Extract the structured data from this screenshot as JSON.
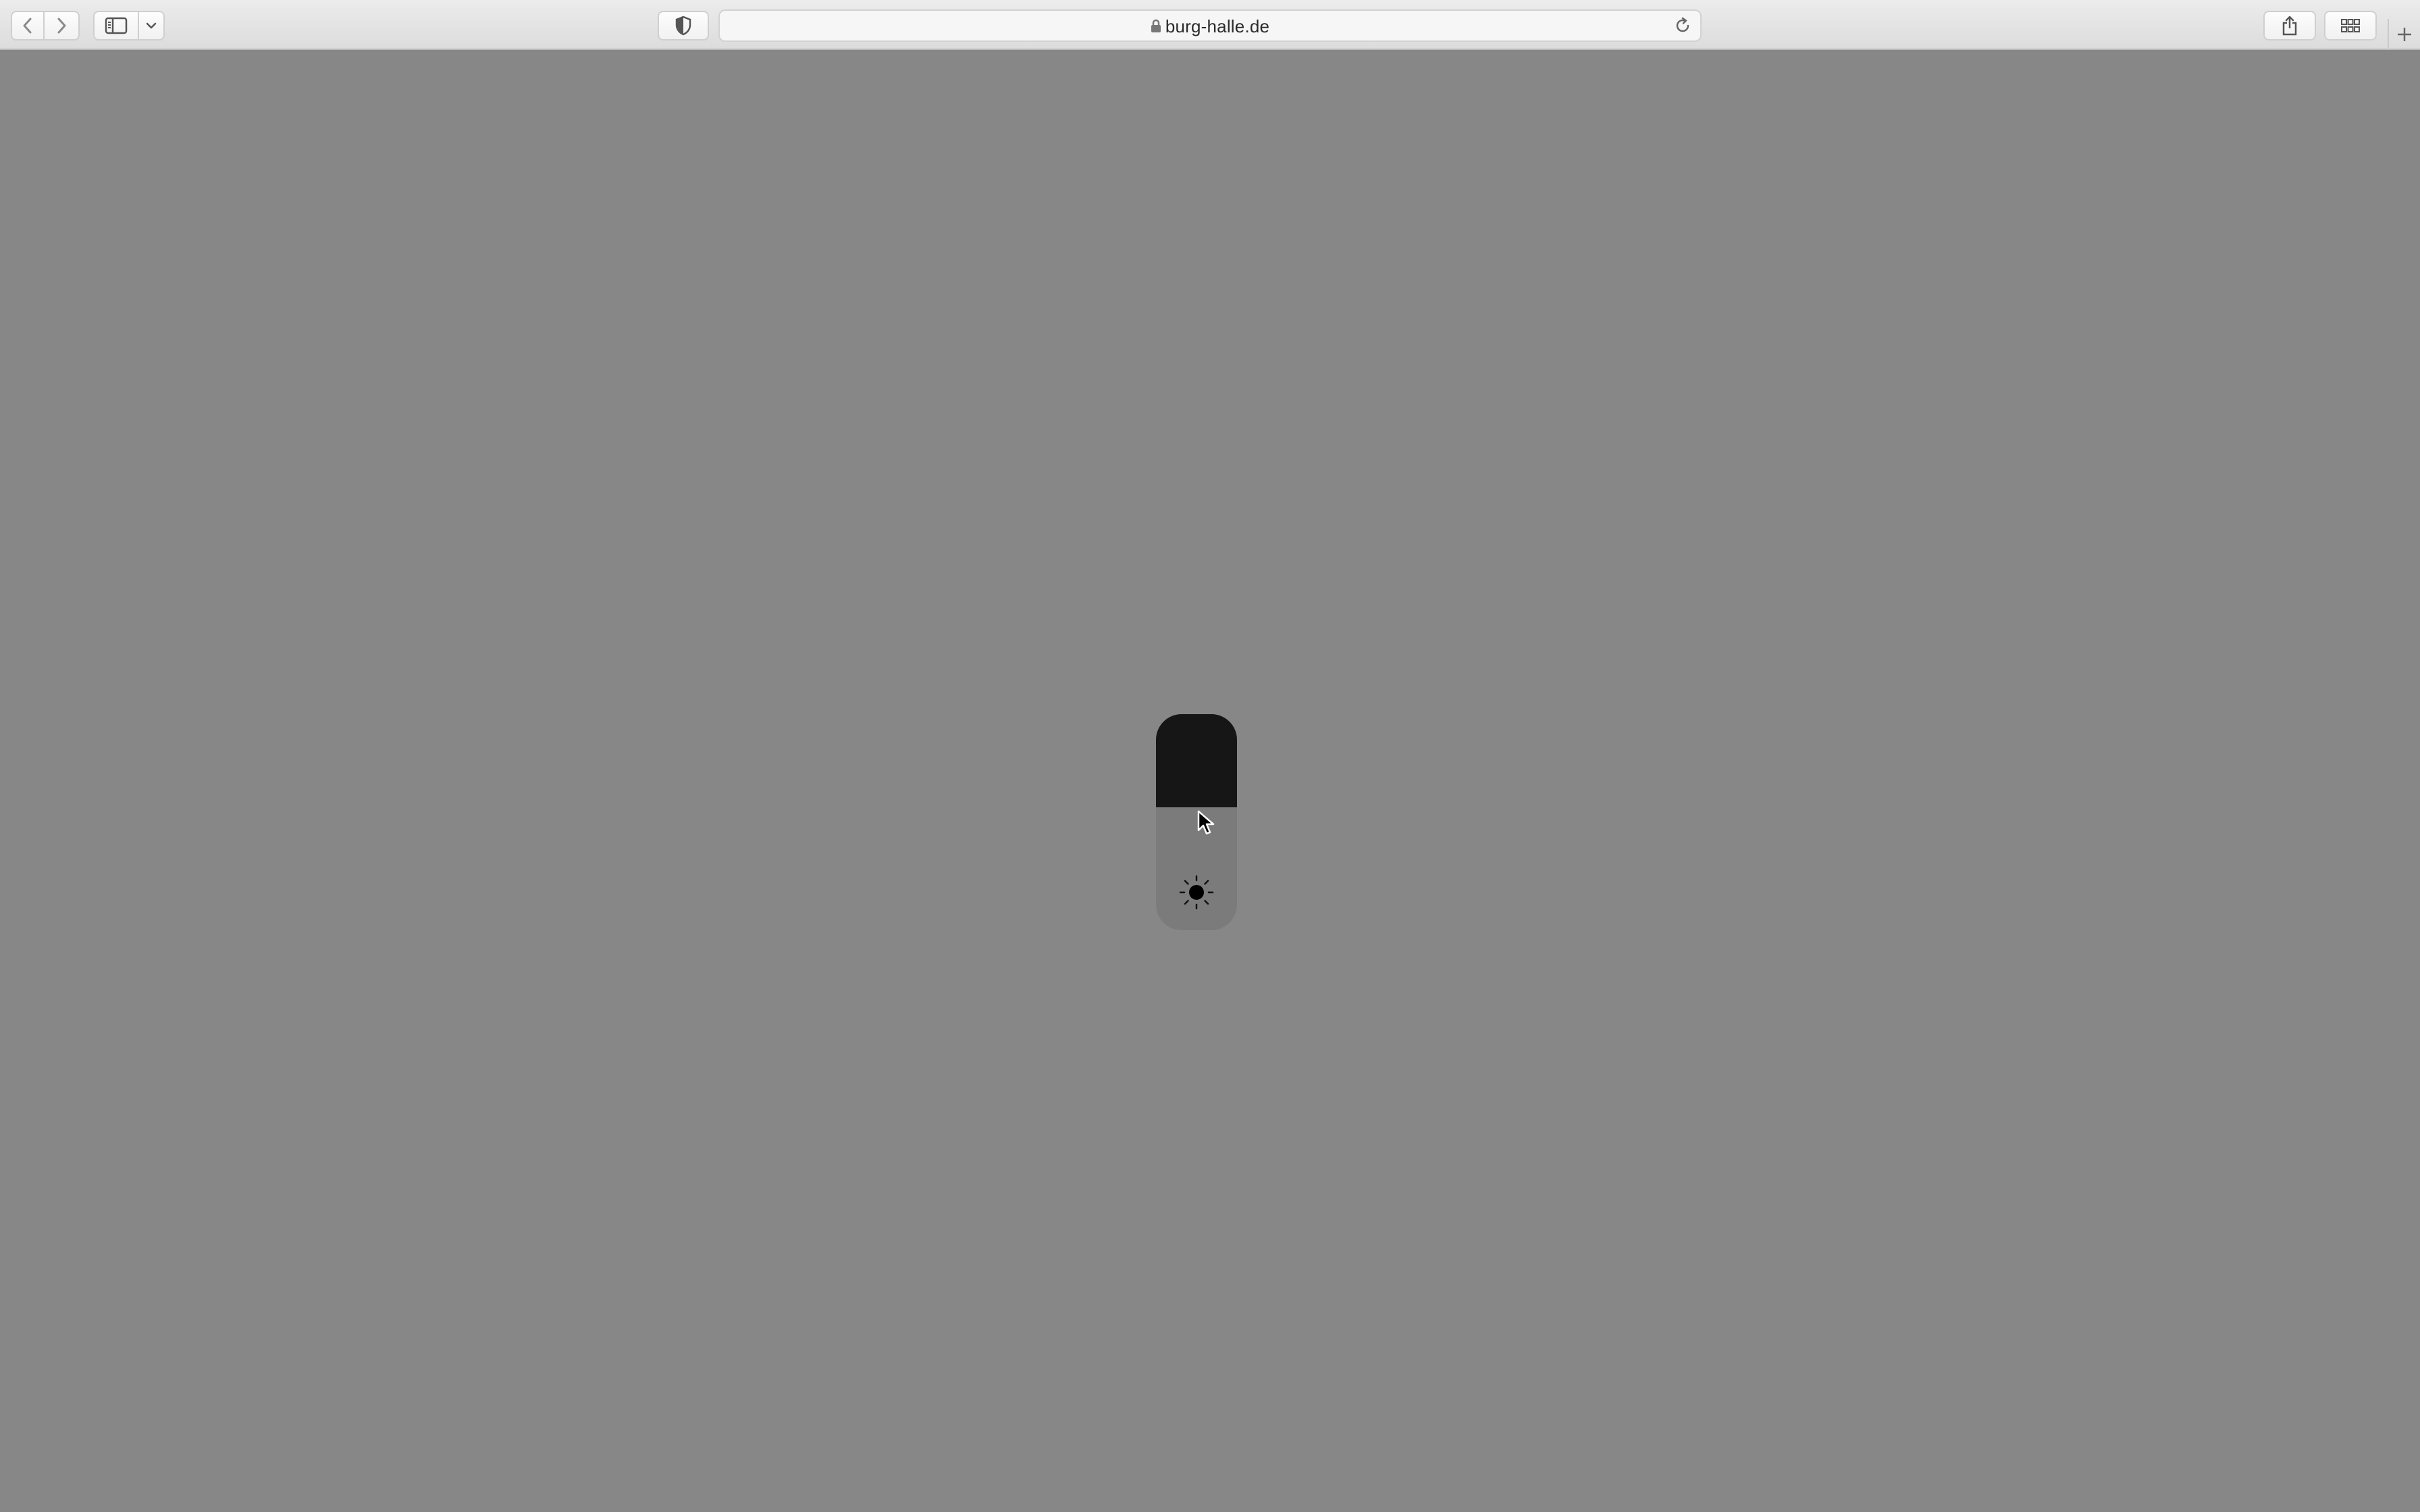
{
  "browser": {
    "address": "burg-halle.de",
    "icons": {
      "back": "chevron-left-icon",
      "forward": "chevron-right-icon",
      "sidebar": "sidebar-icon",
      "sidebar_menu": "chevron-down-icon",
      "privacy": "shield-icon",
      "lock": "lock-icon",
      "reload": "reload-icon",
      "share": "share-icon",
      "tabs": "tab-overview-icon",
      "new_tab": "plus-icon"
    }
  },
  "brightness_control": {
    "icon": "sun-icon",
    "level_fraction": 0.57,
    "fill_color": "#161616",
    "track_color": "#7b7b7b"
  },
  "page": {
    "background": "#878787"
  }
}
